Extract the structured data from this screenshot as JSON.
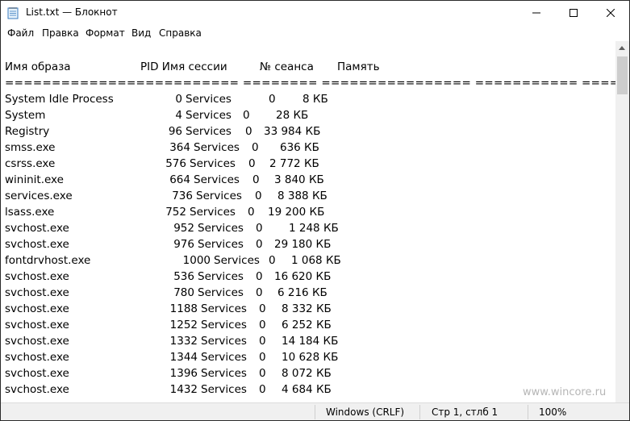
{
  "window": {
    "title": "List.txt — Блокнот"
  },
  "menu": [
    "Файл",
    "Правка",
    "Формат",
    "Вид",
    "Справка"
  ],
  "table": {
    "headers": {
      "name": "Имя образа",
      "pid_session": "PID Имя сессии",
      "session_no": "№ сеанса",
      "memory": "Память"
    },
    "separator": "========================= ======== ================ =========== ============",
    "rows": [
      {
        "name": "System Idle Process",
        "pid": "0",
        "session": "Services",
        "sno": "0",
        "mem": "8 КБ"
      },
      {
        "name": "System",
        "pid": "4",
        "session": "Services",
        "sno": "0",
        "mem": "28 КБ"
      },
      {
        "name": "Registry",
        "pid": "96",
        "session": "Services",
        "sno": "0",
        "mem": "33 984 КБ"
      },
      {
        "name": "smss.exe",
        "pid": "364",
        "session": "Services",
        "sno": "0",
        "mem": "636 КБ"
      },
      {
        "name": "csrss.exe",
        "pid": "576",
        "session": "Services",
        "sno": "0",
        "mem": "2 772 КБ"
      },
      {
        "name": "wininit.exe",
        "pid": "664",
        "session": "Services",
        "sno": "0",
        "mem": "3 840 КБ"
      },
      {
        "name": "services.exe",
        "pid": "736",
        "session": "Services",
        "sno": "0",
        "mem": "8 388 КБ"
      },
      {
        "name": "lsass.exe",
        "pid": "752",
        "session": "Services",
        "sno": "0",
        "mem": "19 200 КБ"
      },
      {
        "name": "svchost.exe",
        "pid": "952",
        "session": "Services",
        "sno": "0",
        "mem": "1 248 КБ"
      },
      {
        "name": "svchost.exe",
        "pid": "976",
        "session": "Services",
        "sno": "0",
        "mem": "29 180 КБ"
      },
      {
        "name": "fontdrvhost.exe",
        "pid": "1000",
        "session": "Services",
        "sno": "0",
        "mem": "1 068 КБ"
      },
      {
        "name": "svchost.exe",
        "pid": "536",
        "session": "Services",
        "sno": "0",
        "mem": "16 620 КБ"
      },
      {
        "name": "svchost.exe",
        "pid": "780",
        "session": "Services",
        "sno": "0",
        "mem": "6 216 КБ"
      },
      {
        "name": "svchost.exe",
        "pid": "1188",
        "session": "Services",
        "sno": "0",
        "mem": "8 332 КБ"
      },
      {
        "name": "svchost.exe",
        "pid": "1252",
        "session": "Services",
        "sno": "0",
        "mem": "6 252 КБ"
      },
      {
        "name": "svchost.exe",
        "pid": "1332",
        "session": "Services",
        "sno": "0",
        "mem": "14 184 КБ"
      },
      {
        "name": "svchost.exe",
        "pid": "1344",
        "session": "Services",
        "sno": "0",
        "mem": "10 628 КБ"
      },
      {
        "name": "svchost.exe",
        "pid": "1396",
        "session": "Services",
        "sno": "0",
        "mem": "8 072 КБ"
      },
      {
        "name": "svchost.exe",
        "pid": "1432",
        "session": "Services",
        "sno": "0",
        "mem": "4 684 КБ"
      }
    ]
  },
  "status": {
    "encoding": "Windows (CRLF)",
    "position": "Стр 1, стлб 1",
    "zoom": "100%"
  },
  "watermark": "www.wincore.ru"
}
